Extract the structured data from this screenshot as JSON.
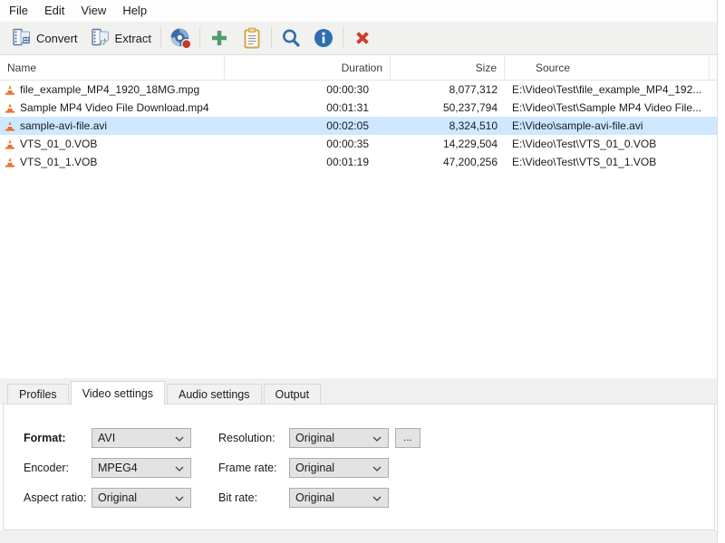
{
  "menu": {
    "items": [
      {
        "label": "File"
      },
      {
        "label": "Edit"
      },
      {
        "label": "View"
      },
      {
        "label": "Help"
      }
    ]
  },
  "toolbar": {
    "convert_label": "Convert",
    "extract_label": "Extract",
    "icons": [
      "film-convert-icon",
      "film-extract-icon",
      "disc-icon",
      "add-icon",
      "paste-icon",
      "search-icon",
      "info-icon",
      "remove-icon"
    ]
  },
  "list": {
    "columns": {
      "name": "Name",
      "duration": "Duration",
      "size": "Size",
      "source": "Source"
    },
    "rows": [
      {
        "name": "file_example_MP4_1920_18MG.mpg",
        "duration": "00:00:30",
        "size": "8,077,312",
        "source": "E:\\Video\\Test\\file_example_MP4_192..."
      },
      {
        "name": "Sample MP4 Video File Download.mp4",
        "duration": "00:01:31",
        "size": "50,237,794",
        "source": "E:\\Video\\Test\\Sample MP4 Video File..."
      },
      {
        "name": "sample-avi-file.avi",
        "duration": "00:02:05",
        "size": "8,324,510",
        "source": "E:\\Video\\sample-avi-file.avi",
        "selected": true
      },
      {
        "name": "VTS_01_0.VOB",
        "duration": "00:00:35",
        "size": "14,229,504",
        "source": "E:\\Video\\Test\\VTS_01_0.VOB"
      },
      {
        "name": "VTS_01_1.VOB",
        "duration": "00:01:19",
        "size": "47,200,256",
        "source": "E:\\Video\\Test\\VTS_01_1.VOB"
      }
    ]
  },
  "tabs": {
    "items": [
      {
        "label": "Profiles"
      },
      {
        "label": "Video settings",
        "active": true
      },
      {
        "label": "Audio settings"
      },
      {
        "label": "Output"
      }
    ]
  },
  "video_settings": {
    "format": {
      "label": "Format:",
      "value": "AVI"
    },
    "encoder": {
      "label": "Encoder:",
      "value": "MPEG4"
    },
    "aspect_ratio": {
      "label": "Aspect ratio:",
      "value": "Original"
    },
    "resolution": {
      "label": "Resolution:",
      "value": "Original"
    },
    "frame_rate": {
      "label": "Frame rate:",
      "value": "Original"
    },
    "bit_rate": {
      "label": "Bit rate:",
      "value": "Original"
    },
    "resolution_more_label": "..."
  },
  "colors": {
    "selection": "#cde8ff",
    "toolbar_bg": "#f1f1f0",
    "accent_blue": "#2f6fae",
    "accent_green": "#4f9d69",
    "accent_red": "#cf3c2e",
    "clipboard_gold": "#cfa83f",
    "cone_orange": "#e8702a"
  }
}
